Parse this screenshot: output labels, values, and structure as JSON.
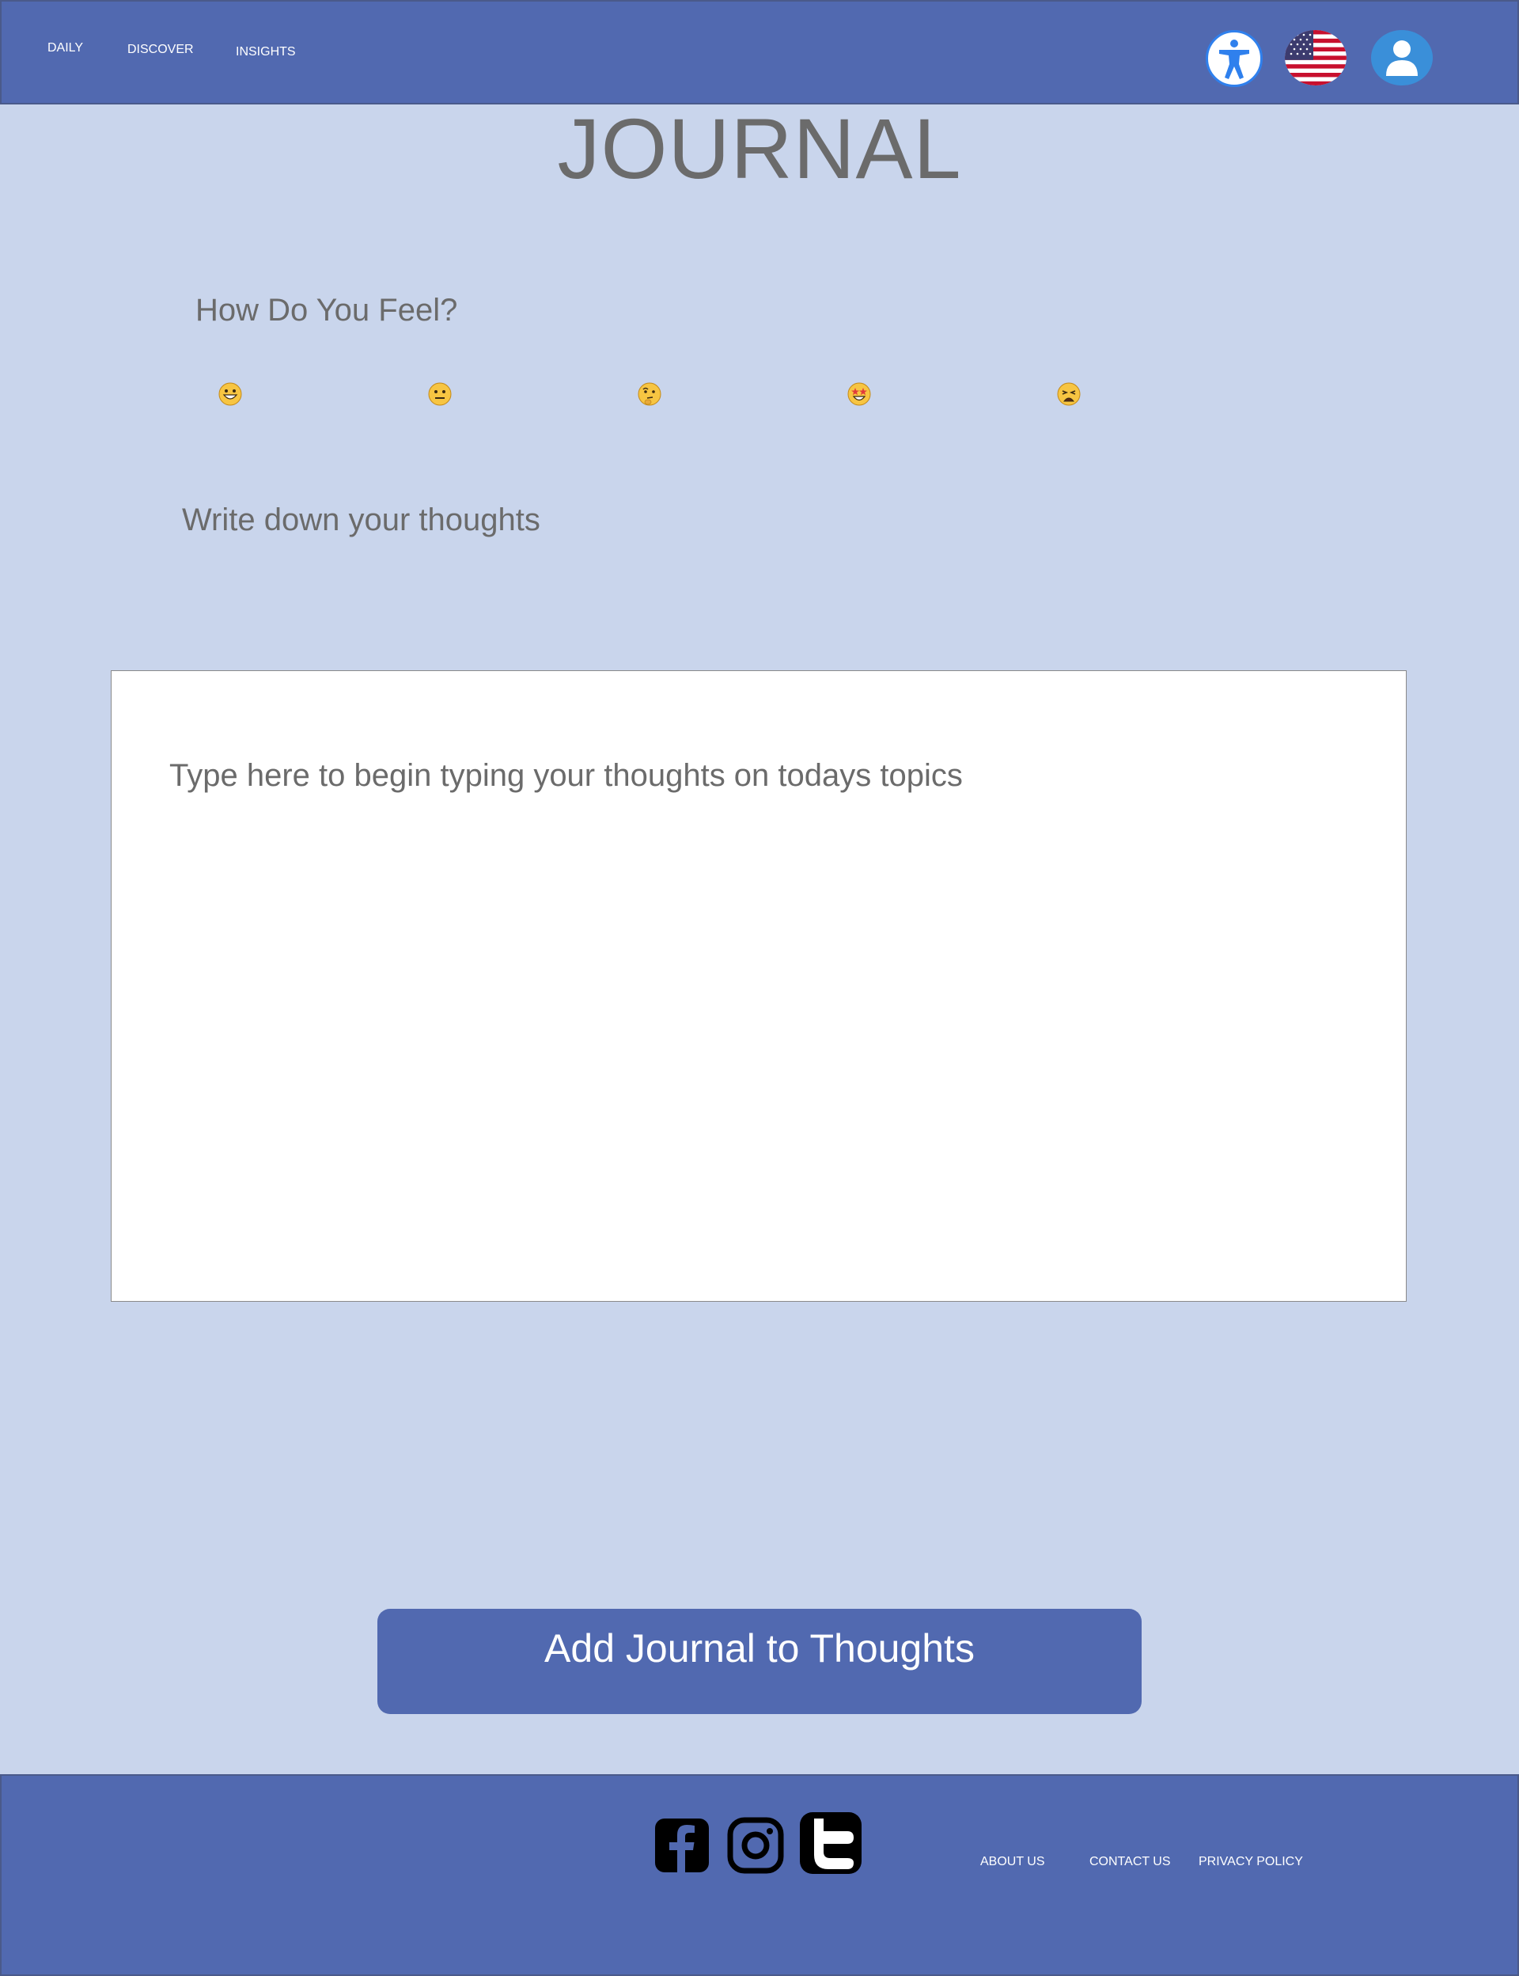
{
  "header": {
    "nav": [
      "DAILY",
      "DISCOVER",
      "INSIGHTS"
    ],
    "icons": [
      "accessibility-icon",
      "us-flag-icon",
      "user-profile-icon"
    ]
  },
  "main": {
    "title": "JOURNAL",
    "feel_label": "How Do You Feel?",
    "moods": [
      "grinning-face",
      "neutral-face",
      "thinking-face",
      "star-struck-face",
      "weary-face"
    ],
    "thoughts_label": "Write down your thoughts",
    "textarea_placeholder": "Type here to begin typing your thoughts on todays topics",
    "add_button": "Add Journal to Thoughts"
  },
  "footer": {
    "social": [
      "facebook-icon",
      "instagram-icon",
      "twitter-icon"
    ],
    "links": [
      "ABOUT US",
      "CONTACT US",
      "PRIVACY POLICY"
    ]
  },
  "colors": {
    "header_bg": "#5169b0",
    "page_bg": "#c9d5ec",
    "text_gray": "#6b6b6b"
  }
}
